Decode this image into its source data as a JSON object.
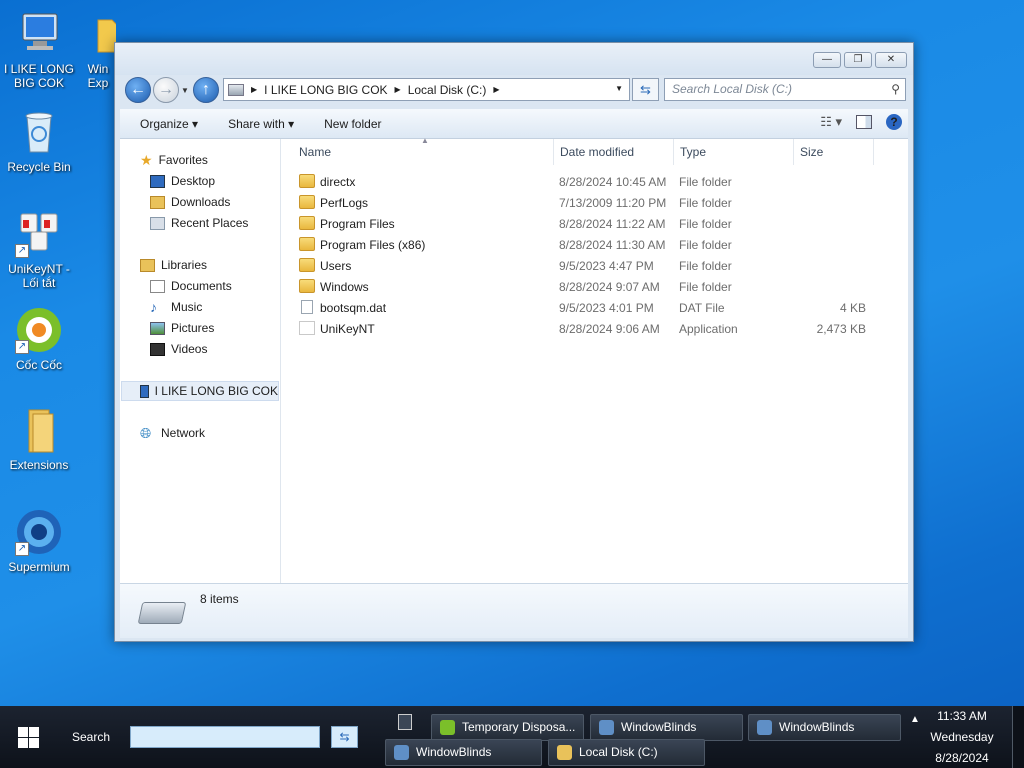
{
  "desktop": {
    "icons": [
      {
        "label": "I LIKE LONG BIG COK",
        "icon": "computer-icon"
      },
      {
        "label": "Win Exp",
        "icon": "folder-icon"
      },
      {
        "label": "Recycle Bin",
        "icon": "recycle-bin-icon"
      },
      {
        "label": "UniKeyNT - Lối tắt",
        "icon": "unikey-icon"
      },
      {
        "label": "Cốc Cốc",
        "icon": "coccoc-icon"
      },
      {
        "label": "Extensions",
        "icon": "folder-icon"
      },
      {
        "label": "Supermium",
        "icon": "supermium-icon"
      }
    ]
  },
  "window": {
    "title": "",
    "caption": {
      "minimize": "—",
      "maximize": "❐",
      "close": "✕"
    },
    "address": {
      "root": "I LIKE LONG BIG COK",
      "current": "Local Disk (C:)"
    },
    "search_placeholder": "Search Local Disk (C:)",
    "toolbar": {
      "organize": "Organize ▾",
      "share_with": "Share with ▾",
      "new_folder": "New folder"
    },
    "nav": {
      "favorites": "Favorites",
      "desktop": "Desktop",
      "downloads": "Downloads",
      "recent_places": "Recent Places",
      "libraries": "Libraries",
      "documents": "Documents",
      "music": "Music",
      "pictures": "Pictures",
      "videos": "Videos",
      "computer": "I LIKE LONG BIG COK",
      "network": "Network"
    },
    "columns": {
      "name": "Name",
      "date": "Date modified",
      "type": "Type",
      "size": "Size"
    },
    "files": [
      {
        "name": "directx",
        "date": "8/28/2024 10:45 AM",
        "type": "File folder",
        "size": "",
        "kind": "folder"
      },
      {
        "name": "PerfLogs",
        "date": "7/13/2009 11:20 PM",
        "type": "File folder",
        "size": "",
        "kind": "folder"
      },
      {
        "name": "Program Files",
        "date": "8/28/2024 11:22 AM",
        "type": "File folder",
        "size": "",
        "kind": "folder"
      },
      {
        "name": "Program Files (x86)",
        "date": "8/28/2024 11:30 AM",
        "type": "File folder",
        "size": "",
        "kind": "folder"
      },
      {
        "name": "Users",
        "date": "9/5/2023 4:47 PM",
        "type": "File folder",
        "size": "",
        "kind": "folder"
      },
      {
        "name": "Windows",
        "date": "8/28/2024 9:07 AM",
        "type": "File folder",
        "size": "",
        "kind": "folder"
      },
      {
        "name": "bootsqm.dat",
        "date": "9/5/2023 4:01 PM",
        "type": "DAT File",
        "size": "4 KB",
        "kind": "file"
      },
      {
        "name": "UniKeyNT",
        "date": "8/28/2024 9:06 AM",
        "type": "Application",
        "size": "2,473 KB",
        "kind": "app"
      }
    ],
    "status": {
      "item_count": "8 items"
    }
  },
  "taskbar": {
    "search_label": "Search",
    "buttons": [
      {
        "label": "Temporary Disposa...",
        "icon": "coccoc-icon"
      },
      {
        "label": "WindowBlinds",
        "icon": "windowblinds-icon"
      },
      {
        "label": "WindowBlinds",
        "icon": "windowblinds-icon"
      },
      {
        "label": "WindowBlinds",
        "icon": "windowblinds-icon"
      },
      {
        "label": "Local Disk (C:)",
        "icon": "explorer-icon"
      }
    ],
    "clock": {
      "time": "11:33 AM",
      "day": "Wednesday",
      "date": "8/28/2024"
    }
  }
}
